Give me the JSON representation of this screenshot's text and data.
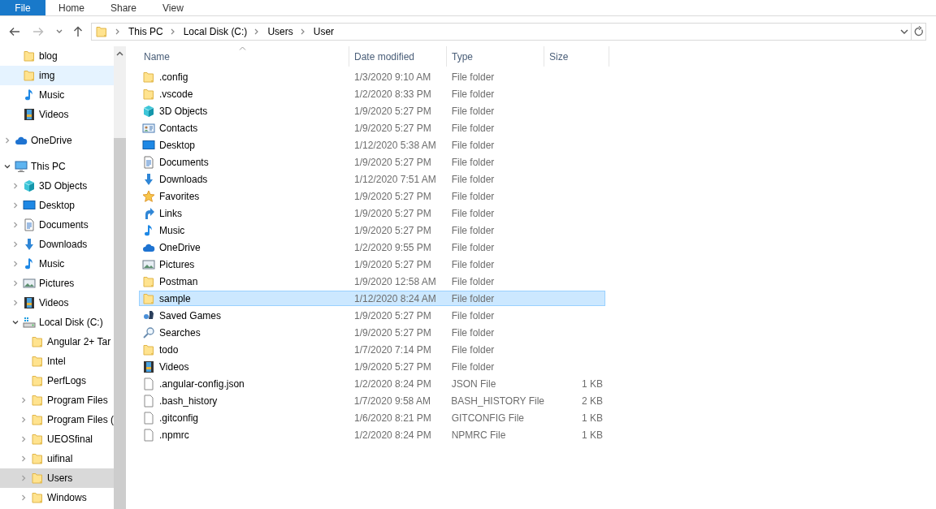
{
  "ribbon_tabs": [
    {
      "label": "File",
      "selected": true
    },
    {
      "label": "Home",
      "selected": false
    },
    {
      "label": "Share",
      "selected": false
    },
    {
      "label": "View",
      "selected": false
    }
  ],
  "breadcrumb": [
    "This PC",
    "Local Disk (C:)",
    "Users",
    "User"
  ],
  "quick_access": [
    {
      "label": "blog",
      "kind": "folder",
      "selected": false,
      "hovered": false
    },
    {
      "label": "img",
      "kind": "folder",
      "selected": false,
      "hovered": true
    },
    {
      "label": "Music",
      "kind": "music",
      "selected": false,
      "hovered": false
    },
    {
      "label": "Videos",
      "kind": "video",
      "selected": false,
      "hovered": false
    }
  ],
  "tree": [
    {
      "label": "OneDrive",
      "kind": "cloud",
      "expandable": true,
      "expanded": false,
      "selected": false,
      "hovered": false
    },
    {
      "label": "This PC",
      "kind": "pc",
      "expandable": true,
      "expanded": true,
      "selected": false,
      "hovered": false,
      "children": [
        {
          "label": "3D Objects",
          "kind": "cube",
          "expandable": true,
          "expanded": false,
          "selected": false,
          "hovered": false
        },
        {
          "label": "Desktop",
          "kind": "desktop",
          "expandable": true,
          "expanded": false,
          "selected": false,
          "hovered": false
        },
        {
          "label": "Documents",
          "kind": "document",
          "expandable": true,
          "expanded": false,
          "selected": false,
          "hovered": false
        },
        {
          "label": "Downloads",
          "kind": "download",
          "expandable": true,
          "expanded": false,
          "selected": false,
          "hovered": false
        },
        {
          "label": "Music",
          "kind": "music",
          "expandable": true,
          "expanded": false,
          "selected": false,
          "hovered": false
        },
        {
          "label": "Pictures",
          "kind": "pictures",
          "expandable": true,
          "expanded": false,
          "selected": false,
          "hovered": false
        },
        {
          "label": "Videos",
          "kind": "video",
          "expandable": true,
          "expanded": false,
          "selected": false,
          "hovered": false
        },
        {
          "label": "Local Disk (C:)",
          "kind": "drive",
          "expandable": true,
          "expanded": true,
          "selected": false,
          "hovered": false,
          "children": [
            {
              "label": "Angular 2+ Tar",
              "kind": "folder",
              "expandable": false,
              "expanded": false,
              "selected": false,
              "hovered": false
            },
            {
              "label": "Intel",
              "kind": "folder",
              "expandable": false,
              "expanded": false,
              "selected": false,
              "hovered": false
            },
            {
              "label": "PerfLogs",
              "kind": "folder",
              "expandable": false,
              "expanded": false,
              "selected": false,
              "hovered": false
            },
            {
              "label": "Program Files",
              "kind": "folder",
              "expandable": true,
              "expanded": false,
              "selected": false,
              "hovered": false
            },
            {
              "label": "Program Files (",
              "kind": "folder",
              "expandable": true,
              "expanded": false,
              "selected": false,
              "hovered": false
            },
            {
              "label": "UEOSfinal",
              "kind": "folder",
              "expandable": true,
              "expanded": false,
              "selected": false,
              "hovered": false
            },
            {
              "label": "uifinal",
              "kind": "folder",
              "expandable": true,
              "expanded": false,
              "selected": false,
              "hovered": false
            },
            {
              "label": "Users",
              "kind": "folder",
              "expandable": true,
              "expanded": false,
              "selected": true,
              "hovered": false
            },
            {
              "label": "Windows",
              "kind": "folder",
              "expandable": true,
              "expanded": false,
              "selected": false,
              "hovered": false
            }
          ]
        }
      ]
    }
  ],
  "columns": [
    "Name",
    "Date modified",
    "Type",
    "Size"
  ],
  "files": [
    {
      "name": ".config",
      "kind": "folder",
      "date": "1/3/2020 9:10 AM",
      "type": "File folder",
      "selected": false
    },
    {
      "name": ".vscode",
      "kind": "folder",
      "date": "1/2/2020 8:33 PM",
      "type": "File folder",
      "selected": false
    },
    {
      "name": "3D Objects",
      "kind": "cube",
      "date": "1/9/2020 5:27 PM",
      "type": "File folder",
      "selected": false
    },
    {
      "name": "Contacts",
      "kind": "contacts",
      "date": "1/9/2020 5:27 PM",
      "type": "File folder",
      "selected": false
    },
    {
      "name": "Desktop",
      "kind": "desktop",
      "date": "1/12/2020 5:38 AM",
      "type": "File folder",
      "selected": false
    },
    {
      "name": "Documents",
      "kind": "document",
      "date": "1/9/2020 5:27 PM",
      "type": "File folder",
      "selected": false
    },
    {
      "name": "Downloads",
      "kind": "download",
      "date": "1/12/2020 7:51 AM",
      "type": "File folder",
      "selected": false
    },
    {
      "name": "Favorites",
      "kind": "star",
      "date": "1/9/2020 5:27 PM",
      "type": "File folder",
      "selected": false
    },
    {
      "name": "Links",
      "kind": "link",
      "date": "1/9/2020 5:27 PM",
      "type": "File folder",
      "selected": false
    },
    {
      "name": "Music",
      "kind": "music",
      "date": "1/9/2020 5:27 PM",
      "type": "File folder",
      "selected": false
    },
    {
      "name": "OneDrive",
      "kind": "cloud",
      "date": "1/2/2020 9:55 PM",
      "type": "File folder",
      "selected": false
    },
    {
      "name": "Pictures",
      "kind": "pictures",
      "date": "1/9/2020 5:27 PM",
      "type": "File folder",
      "selected": false
    },
    {
      "name": "Postman",
      "kind": "folder",
      "date": "1/9/2020 12:58 AM",
      "type": "File folder",
      "selected": false
    },
    {
      "name": "sample",
      "kind": "folder",
      "date": "1/12/2020 8:24 AM",
      "type": "File folder",
      "selected": true
    },
    {
      "name": "Saved Games",
      "kind": "games",
      "date": "1/9/2020 5:27 PM",
      "type": "File folder",
      "selected": false
    },
    {
      "name": "Searches",
      "kind": "search",
      "date": "1/9/2020 5:27 PM",
      "type": "File folder",
      "selected": false
    },
    {
      "name": "todo",
      "kind": "folder",
      "date": "1/7/2020 7:14 PM",
      "type": "File folder",
      "selected": false
    },
    {
      "name": "Videos",
      "kind": "video",
      "date": "1/9/2020 5:27 PM",
      "type": "File folder",
      "selected": false
    },
    {
      "name": ".angular-config.json",
      "kind": "file",
      "date": "1/2/2020 8:24 PM",
      "type": "JSON File",
      "size": "1 KB",
      "selected": false
    },
    {
      "name": ".bash_history",
      "kind": "file",
      "date": "1/7/2020 9:58 AM",
      "type": "BASH_HISTORY File",
      "size": "2 KB",
      "selected": false
    },
    {
      "name": ".gitconfig",
      "kind": "file",
      "date": "1/6/2020 8:21 PM",
      "type": "GITCONFIG File",
      "size": "1 KB",
      "selected": false
    },
    {
      "name": ".npmrc",
      "kind": "file",
      "date": "1/2/2020 8:24 PM",
      "type": "NPMRC File",
      "size": "1 KB",
      "selected": false
    }
  ]
}
